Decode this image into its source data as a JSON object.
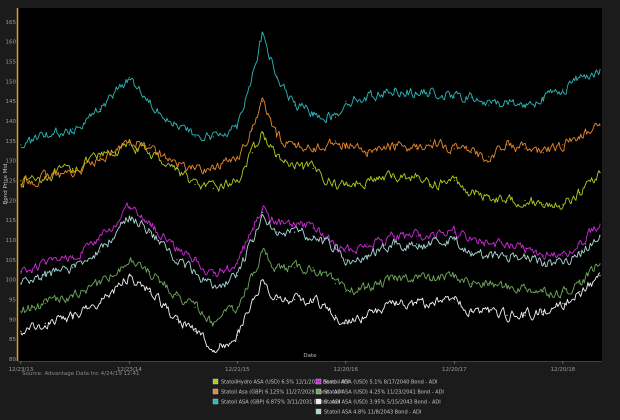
{
  "chart_data": {
    "type": "line",
    "ylabel": "Bond Price Mid",
    "xlabel": "Date",
    "ylim": [
      80,
      168
    ],
    "yticks": [
      80,
      85,
      90,
      95,
      100,
      105,
      110,
      115,
      120,
      125,
      130,
      135,
      140,
      145,
      150,
      155,
      160,
      165
    ],
    "xlim": [
      "2013-12-20",
      "2019-04-24"
    ],
    "xticks": [
      {
        "date": "2013-12-23",
        "label": "12/23/13"
      },
      {
        "date": "2014-12-23",
        "label": "12/23/14"
      },
      {
        "date": "2015-12-21",
        "label": "12/21/15"
      },
      {
        "date": "2016-12-20",
        "label": "12/20/16"
      },
      {
        "date": "2017-12-20",
        "label": "12/20/17"
      },
      {
        "date": "2018-12-20",
        "label": "12/20/18"
      }
    ],
    "source": "Source: Advantage Data Inc 4/24/19 12:41",
    "grid": false,
    "legend_position": "bottom",
    "series": [
      {
        "name": "StatoilHydro ASA (USD) 6.5% 12/1/2028 Bond - ADI",
        "color": "#b5c81c",
        "x": [
          "2013-12-23",
          "2014-03-15",
          "2014-06-15",
          "2014-09-15",
          "2014-12-23",
          "2015-03-01",
          "2015-06-01",
          "2015-08-01",
          "2015-10-01",
          "2015-12-21",
          "2016-02-10",
          "2016-03-15",
          "2016-05-01",
          "2016-07-01",
          "2016-09-01",
          "2016-11-15",
          "2016-12-20",
          "2017-03-01",
          "2017-06-01",
          "2017-08-15",
          "2017-10-01",
          "2017-12-20",
          "2018-02-15",
          "2018-04-15",
          "2018-06-15",
          "2018-08-15",
          "2018-10-15",
          "2018-12-20",
          "2019-02-15",
          "2019-04-24"
        ],
        "y": [
          125,
          126,
          128,
          131,
          134,
          132,
          128,
          124,
          123,
          125,
          132,
          137,
          131,
          128,
          128,
          124,
          124,
          125,
          126,
          126,
          124,
          125,
          122,
          121,
          120,
          120,
          119,
          119,
          122,
          127
        ]
      },
      {
        "name": "Statoil Asa (GBP) 6.125% 11/27/2028 Bond - ADI",
        "color": "#e8882a",
        "x": [
          "2013-12-23",
          "2014-03-15",
          "2014-06-15",
          "2014-09-15",
          "2014-12-23",
          "2015-03-01",
          "2015-06-01",
          "2015-08-01",
          "2015-10-01",
          "2015-12-21",
          "2016-02-10",
          "2016-03-15",
          "2016-05-01",
          "2016-07-01",
          "2016-09-01",
          "2016-11-15",
          "2016-12-20",
          "2017-03-01",
          "2017-06-01",
          "2017-08-15",
          "2017-10-01",
          "2017-12-20",
          "2018-02-15",
          "2018-04-15",
          "2018-06-15",
          "2018-08-15",
          "2018-10-15",
          "2018-12-20",
          "2019-02-15",
          "2019-04-24"
        ],
        "y": [
          124,
          126,
          127,
          130,
          135,
          134,
          129,
          128,
          128,
          131,
          138,
          145,
          136,
          134,
          133,
          135,
          134,
          132,
          134,
          133,
          135,
          133,
          132,
          131,
          134,
          133,
          132,
          134,
          136,
          139
        ]
      },
      {
        "name": "Statoil ASA (GBP) 6.875% 3/11/2031 Bond - ADI",
        "color": "#2ab8b8",
        "x": [
          "2013-12-23",
          "2014-03-15",
          "2014-06-15",
          "2014-09-15",
          "2014-12-23",
          "2015-03-01",
          "2015-06-01",
          "2015-08-01",
          "2015-10-01",
          "2015-12-21",
          "2016-02-10",
          "2016-03-15",
          "2016-05-01",
          "2016-07-01",
          "2016-09-01",
          "2016-11-15",
          "2016-12-20",
          "2017-03-01",
          "2017-06-01",
          "2017-08-15",
          "2017-10-01",
          "2017-12-20",
          "2018-02-15",
          "2018-04-15",
          "2018-06-15",
          "2018-08-15",
          "2018-10-15",
          "2018-12-20",
          "2019-02-15",
          "2019-04-24"
        ],
        "y": [
          134,
          136,
          138,
          143,
          151,
          145,
          139,
          136,
          136,
          139,
          152,
          162,
          151,
          144,
          142,
          141,
          145,
          146,
          148,
          147,
          147,
          146,
          146,
          144,
          145,
          144,
          146,
          148,
          151,
          153
        ]
      },
      {
        "name": "Statoil ASA (USD) 5.1% 8/17/2040 Bond - ADI",
        "color": "#cc2bd6",
        "x": [
          "2013-12-23",
          "2014-03-15",
          "2014-06-15",
          "2014-09-15",
          "2014-12-23",
          "2015-03-01",
          "2015-06-01",
          "2015-08-01",
          "2015-10-01",
          "2015-12-21",
          "2016-02-10",
          "2016-03-15",
          "2016-05-01",
          "2016-07-01",
          "2016-09-01",
          "2016-11-15",
          "2016-12-20",
          "2017-03-01",
          "2017-06-01",
          "2017-08-15",
          "2017-10-01",
          "2017-12-20",
          "2018-02-15",
          "2018-04-15",
          "2018-06-15",
          "2018-08-15",
          "2018-10-15",
          "2018-12-20",
          "2019-02-15",
          "2019-04-24"
        ],
        "y": [
          102,
          104,
          106,
          110,
          118,
          114,
          108,
          105,
          101,
          104,
          113,
          118,
          114,
          114,
          113,
          109,
          107,
          109,
          111,
          111,
          111,
          112,
          110,
          109,
          109,
          108,
          106,
          106,
          109,
          114
        ]
      },
      {
        "name": "Statoil ASA (USD) 4.25% 11/23/2041 Bond - ADI",
        "color": "#6fa85a",
        "x": [
          "2013-12-23",
          "2014-03-15",
          "2014-06-15",
          "2014-09-15",
          "2014-12-23",
          "2015-03-01",
          "2015-06-01",
          "2015-08-01",
          "2015-10-01",
          "2015-12-21",
          "2016-02-10",
          "2016-03-15",
          "2016-05-01",
          "2016-07-01",
          "2016-09-01",
          "2016-11-15",
          "2016-12-20",
          "2017-03-01",
          "2017-06-01",
          "2017-08-15",
          "2017-10-01",
          "2017-12-20",
          "2018-02-15",
          "2018-04-15",
          "2018-06-15",
          "2018-08-15",
          "2018-10-15",
          "2018-12-20",
          "2019-02-15",
          "2019-04-24"
        ],
        "y": [
          92,
          94,
          96,
          99,
          105,
          102,
          96,
          93,
          89,
          93,
          101,
          107,
          103,
          103,
          103,
          99,
          97,
          98,
          100,
          101,
          100,
          101,
          99,
          99,
          98,
          98,
          97,
          97,
          99,
          104
        ]
      },
      {
        "name": "Statoil ASA (USD) 3.95% 5/15/2043 Bond - ADI",
        "color": "#f2f2f2",
        "x": [
          "2013-12-23",
          "2014-03-15",
          "2014-06-15",
          "2014-09-15",
          "2014-12-23",
          "2015-03-01",
          "2015-06-01",
          "2015-08-01",
          "2015-10-01",
          "2015-12-21",
          "2016-02-10",
          "2016-03-15",
          "2016-05-01",
          "2016-07-01",
          "2016-09-01",
          "2016-11-15",
          "2016-12-20",
          "2017-03-01",
          "2017-06-01",
          "2017-08-15",
          "2017-10-01",
          "2017-12-20",
          "2018-02-15",
          "2018-04-15",
          "2018-06-15",
          "2018-08-15",
          "2018-10-15",
          "2018-12-20",
          "2019-02-15",
          "2019-04-24"
        ],
        "y": [
          87,
          89,
          91,
          94,
          101,
          97,
          90,
          87,
          82,
          86,
          95,
          100,
          95,
          95,
          95,
          91,
          89,
          91,
          94,
          94,
          94,
          95,
          92,
          92,
          91,
          91,
          92,
          94,
          97,
          101
        ]
      },
      {
        "name": "Statoil ASA 4.8% 11/8/2043 Bond - ADI",
        "color": "#a9d6d6",
        "x": [
          "2013-12-23",
          "2014-03-15",
          "2014-06-15",
          "2014-09-15",
          "2014-12-23",
          "2015-03-01",
          "2015-06-01",
          "2015-08-01",
          "2015-10-01",
          "2015-12-21",
          "2016-02-10",
          "2016-03-15",
          "2016-05-01",
          "2016-07-01",
          "2016-09-01",
          "2016-11-15",
          "2016-12-20",
          "2017-03-01",
          "2017-06-01",
          "2017-08-15",
          "2017-10-01",
          "2017-12-20",
          "2018-02-15",
          "2018-04-15",
          "2018-06-15",
          "2018-08-15",
          "2018-10-15",
          "2018-12-20",
          "2019-02-15",
          "2019-04-24"
        ],
        "y": [
          99,
          101,
          103,
          107,
          116,
          112,
          105,
          102,
          98,
          101,
          110,
          117,
          112,
          112,
          111,
          108,
          105,
          106,
          109,
          109,
          109,
          110,
          107,
          106,
          106,
          106,
          104,
          104,
          107,
          111
        ]
      }
    ]
  }
}
